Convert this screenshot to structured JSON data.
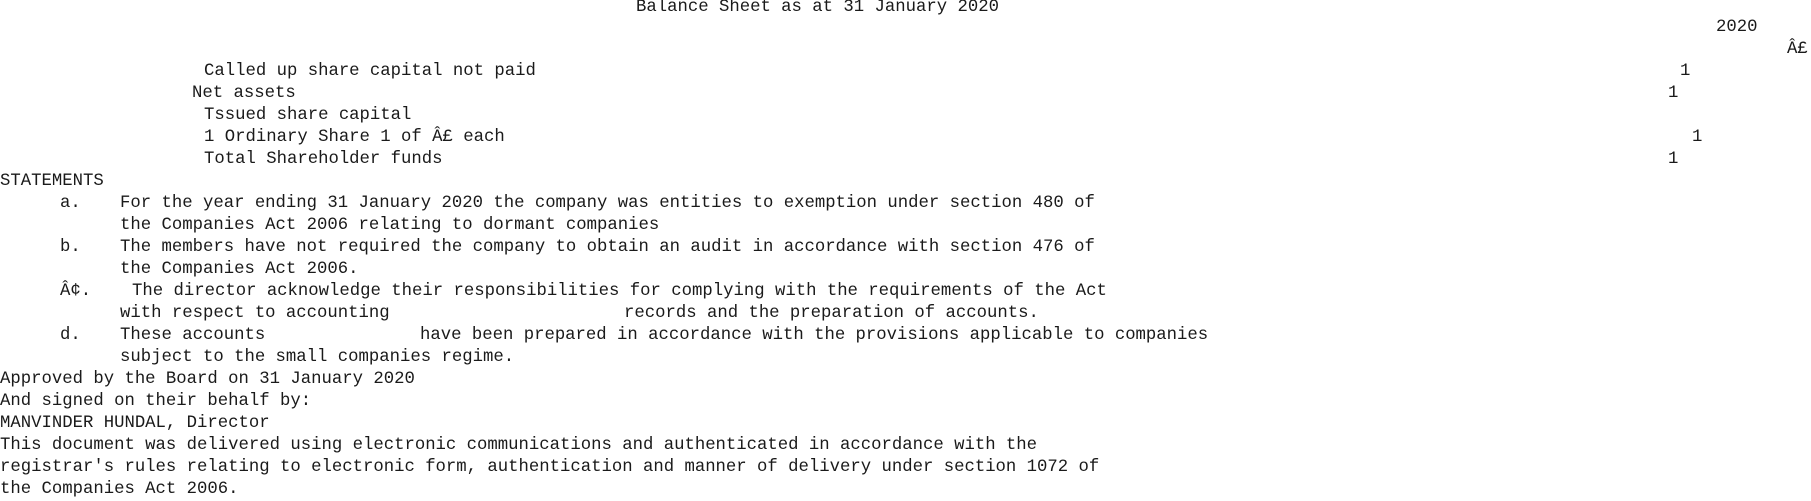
{
  "title": "Balance Sheet as at 31 January 2020",
  "column_header": {
    "year": "2020",
    "currency": "Â£"
  },
  "balance_sheet": {
    "called_up_label": "Called up share capital not paid",
    "called_up_value": "1",
    "net_assets_label": "Net assets",
    "net_assets_value": "1",
    "issued_label": "Tssued share capital",
    "ordinary_share_label": "1 Ordinary Share 1 of Â£ each",
    "ordinary_share_value": "1",
    "total_label": "Total Shareholder funds",
    "total_value": "1"
  },
  "statements": {
    "heading": "STATEMENTS",
    "items": [
      {
        "marker": "a.",
        "line1": "For the year ending 31 January 2020 the company was entities to exemption under section 480 of",
        "line2": "the Companies Act 2006 relating to dormant companies"
      },
      {
        "marker": "b.",
        "line1": "The members have not required the company to obtain an audit in accordance with section 476 of",
        "line2": "the Companies Act 2006."
      },
      {
        "marker": "Â¢.",
        "line1": "The director acknowledge their responsibilities for complying with the requirements of the Act",
        "line2a": "with respect to accounting",
        "line2b": "records and the preparation of accounts."
      },
      {
        "marker": "d.",
        "line1a": "These accounts",
        "line1b": "have been prepared in accordance with the provisions applicable to companies",
        "line2": "subject to the small companies regime."
      }
    ]
  },
  "approval": {
    "approved": "Approved by the Board on 31 January 2020",
    "signed": "And signed on their behalf by:",
    "director": "MANVINDER HUNDAL, Director"
  },
  "footer": {
    "line1": "This document was delivered using electronic communications and authenticated in accordance with the",
    "line2": "registrar's rules relating to electronic form, authentication and manner of delivery under section 1072 of",
    "line3": "the Companies Act 2006."
  }
}
